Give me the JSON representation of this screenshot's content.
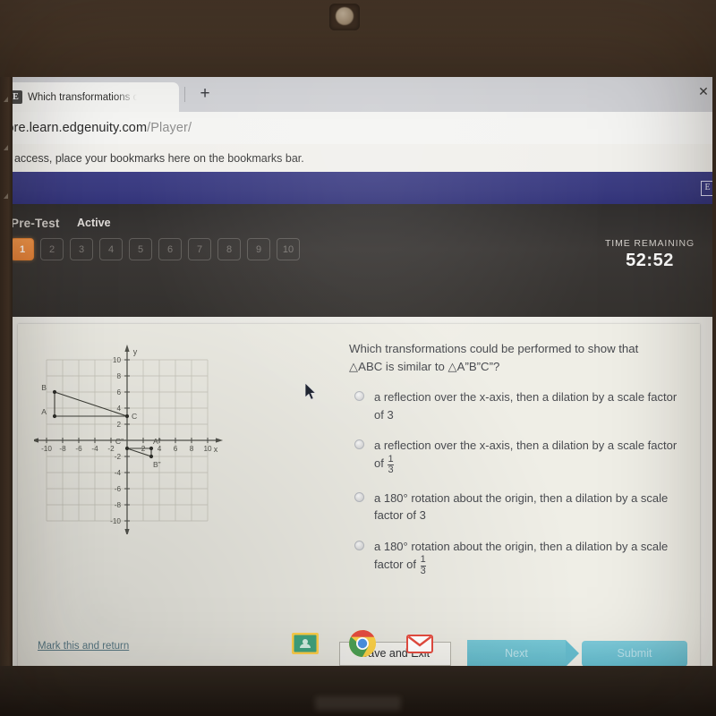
{
  "browser": {
    "tab": {
      "favicon_letter": "E",
      "title": "Which transformations could be",
      "close_label": "✕"
    },
    "new_tab_label": "+",
    "url_host": "core.learn.edgenuity.com",
    "url_path": "/Player/",
    "bookmarks_hint": "ck access, place your bookmarks here on the bookmarks bar.",
    "brand_mark": "E"
  },
  "quiz_header": {
    "section_label": "Pre-Test",
    "status_label": "Active",
    "question_numbers": [
      "1",
      "2",
      "3",
      "4",
      "5",
      "6",
      "7",
      "8",
      "9",
      "10"
    ],
    "active_question": "1",
    "time_remaining_label": "TIME REMAINING",
    "time_remaining_value": "52:52",
    "active_color": "#ee8c3f"
  },
  "question": {
    "line1": "Which transformations could be performed to show that",
    "line2_pre": "△ABC is similar to △A”B”C”?",
    "options": [
      {
        "text": "a reflection over the x-axis, then a dilation by a scale factor of 3",
        "has_fraction": false,
        "selected": false
      },
      {
        "text_before": "a reflection over the x-axis, then a dilation by a scale factor of",
        "fraction_num": "1",
        "fraction_den": "3",
        "has_fraction": true,
        "selected": false
      },
      {
        "text": "a 180° rotation about the origin, then a dilation by a scale factor of 3",
        "has_fraction": false,
        "selected": false
      },
      {
        "text_before": "a 180° rotation about the origin, then a dilation by a scale factor of",
        "fraction_num": "1",
        "fraction_den": "3",
        "has_fraction": true,
        "selected": false
      }
    ]
  },
  "chart_data": {
    "type": "scatter",
    "title": "",
    "xlabel": "x",
    "ylabel": "y",
    "xlim": [
      -11,
      11
    ],
    "ylim": [
      -11,
      11
    ],
    "grid": true,
    "x_ticks": [
      "-10",
      "-8",
      "-6",
      "-4",
      "-2",
      "2",
      "4",
      "6",
      "8",
      "10"
    ],
    "y_ticks": [
      "10",
      "8",
      "6",
      "4",
      "2",
      "-2",
      "-4",
      "-6",
      "-8",
      "-10"
    ],
    "legend": "none",
    "series": [
      {
        "name": "triangle ABC",
        "points": [
          {
            "label": "A",
            "x": -9,
            "y": 3
          },
          {
            "label": "B",
            "x": -9,
            "y": 6
          },
          {
            "label": "C",
            "x": 0,
            "y": 3
          }
        ]
      },
      {
        "name": "triangle A”B”C”",
        "points": [
          {
            "label": "C”",
            "x": 0,
            "y": -1
          },
          {
            "label": "A”",
            "x": 3,
            "y": -1
          },
          {
            "label": "B”",
            "x": 3,
            "y": -2
          }
        ]
      }
    ]
  },
  "footer": {
    "mark_link": "Mark this and return",
    "save_label": "Save and Exit",
    "next_label": "Next",
    "submit_label": "Submit",
    "accent_color": "#6dc2d2"
  },
  "taskbar": {
    "items": [
      {
        "name": "google-classroom-icon",
        "label": "Classroom"
      },
      {
        "name": "chrome-icon",
        "label": "Chrome"
      },
      {
        "name": "gmail-icon",
        "label": "Gmail"
      }
    ]
  }
}
